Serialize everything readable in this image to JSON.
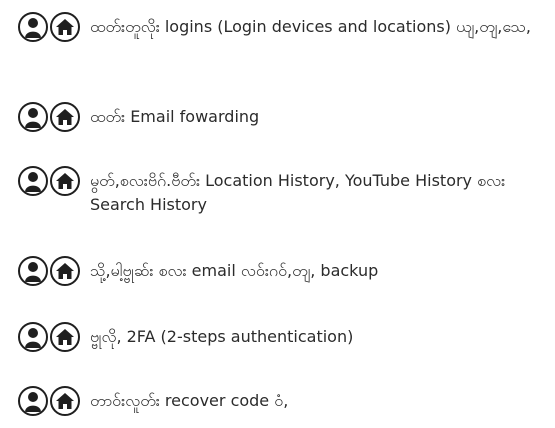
{
  "items": [
    {
      "text": "ထတ်းတူလိုး logins (Login devices and locations) ယျ,တျ,သေ,"
    },
    {
      "text": "ထတ်း Email fowarding"
    },
    {
      "text": "မွတ်,စလးဗိဂ်.ဗီတ်း Location History, YouTube History စလး Search History"
    },
    {
      "text": "သို့,မါ့ဗ္ဗုဆ်း စလး email လဝ်းဂဝ်,တျ, backup"
    },
    {
      "text": "ဗ္ဗုလို, 2FA (2-steps authentication)"
    },
    {
      "text": "တာဝ်းလူတ်း recover code ဝံ,"
    }
  ],
  "icons": {
    "first": "person-icon",
    "second": "home-icon",
    "stroke_color": "#1f1f1f"
  }
}
